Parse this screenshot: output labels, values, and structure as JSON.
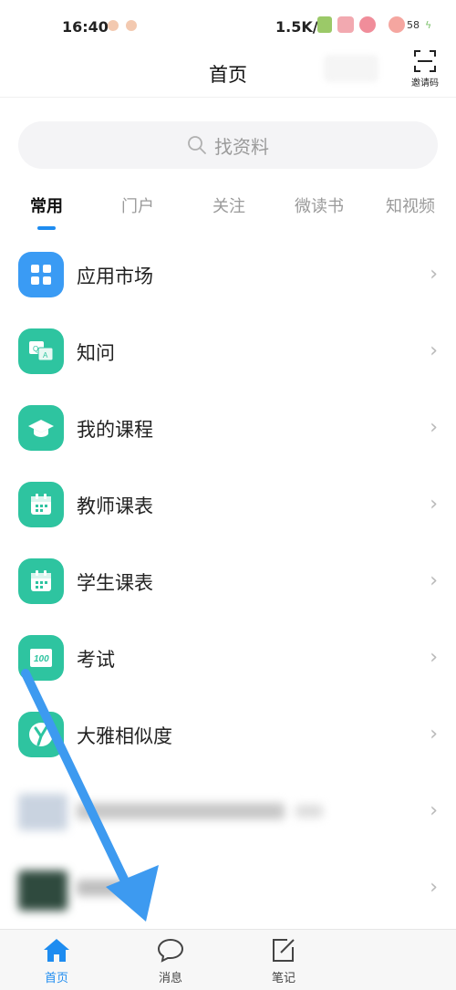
{
  "status_bar": {
    "time": "16:40",
    "network_speed": "1.5K/s",
    "battery_level": "58"
  },
  "header": {
    "title": "首页",
    "invite_label": "邀请码"
  },
  "search": {
    "placeholder": "找资料"
  },
  "tabs": [
    {
      "label": "常用",
      "active": true
    },
    {
      "label": "门户",
      "active": false
    },
    {
      "label": "关注",
      "active": false
    },
    {
      "label": "微读书",
      "active": false
    },
    {
      "label": "知视频",
      "active": false
    }
  ],
  "menu": [
    {
      "label": "应用市场",
      "icon": "grid-icon",
      "color": "#3a9bf4"
    },
    {
      "label": "知问",
      "icon": "qa-icon",
      "color": "#2ec4a0"
    },
    {
      "label": "我的课程",
      "icon": "graduation-cap-icon",
      "color": "#2ec4a0"
    },
    {
      "label": "教师课表",
      "icon": "calendar-icon",
      "color": "#2ec4a0"
    },
    {
      "label": "学生课表",
      "icon": "calendar-icon",
      "color": "#2ec4a0"
    },
    {
      "label": "考试",
      "icon": "score-100-icon",
      "color": "#2ec4a0"
    },
    {
      "label": "大雅相似度",
      "icon": "daya-icon",
      "color": "#2ec4a0"
    }
  ],
  "bottom_nav": [
    {
      "label": "首页",
      "icon": "home-icon",
      "active": true
    },
    {
      "label": "消息",
      "icon": "chat-bubble-icon",
      "active": false
    },
    {
      "label": "笔记",
      "icon": "note-edit-icon",
      "active": false
    }
  ],
  "colors": {
    "accent": "#1e8cf0",
    "icon_green": "#2ec4a0",
    "icon_blue": "#3a9bf4",
    "annotation_arrow": "#3d9af0"
  }
}
